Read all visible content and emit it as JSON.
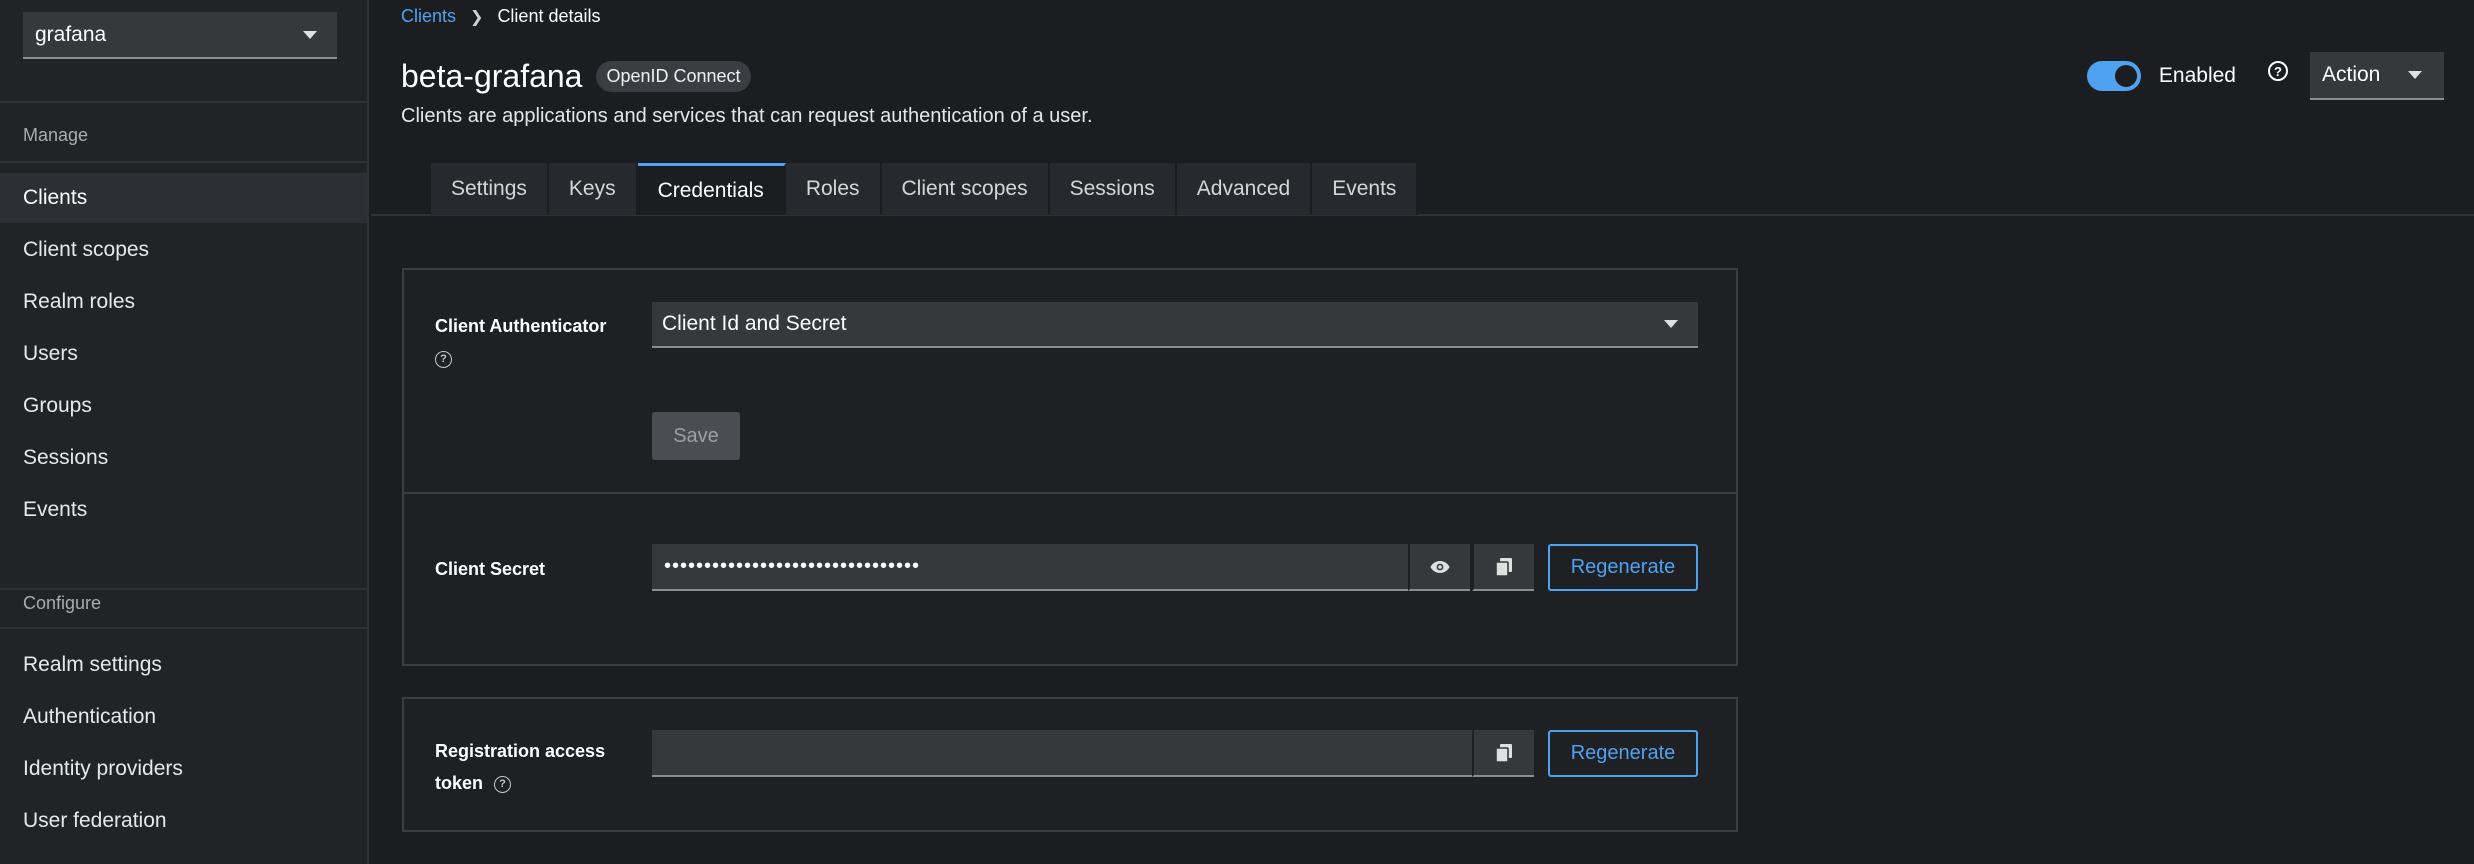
{
  "sidebar": {
    "realm": "grafana",
    "manage_label": "Manage",
    "configure_label": "Configure",
    "manage_items": [
      "Clients",
      "Client scopes",
      "Realm roles",
      "Users",
      "Groups",
      "Sessions",
      "Events"
    ],
    "configure_items": [
      "Realm settings",
      "Authentication",
      "Identity providers",
      "User federation"
    ]
  },
  "breadcrumb": {
    "parent": "Clients",
    "current": "Client details"
  },
  "header": {
    "title": "beta-grafana",
    "badge": "OpenID Connect",
    "subtitle": "Clients are applications and services that can request authentication of a user.",
    "enabled_label": "Enabled",
    "enabled": true,
    "action_label": "Action"
  },
  "tabs": [
    "Settings",
    "Keys",
    "Credentials",
    "Roles",
    "Client scopes",
    "Sessions",
    "Advanced",
    "Events"
  ],
  "active_tab": "Credentials",
  "credentials": {
    "authenticator_label": "Client Authenticator",
    "authenticator_value": "Client Id and Secret",
    "save_label": "Save",
    "secret_label": "Client Secret",
    "secret_value": "••••••••••••••••••••••••••••••••",
    "regenerate_label": "Regenerate",
    "registration_label_line1": "Registration access",
    "registration_label_line2": "token",
    "registration_value": ""
  },
  "colors": {
    "accent": "#4ea2f0",
    "background": "#1b1d21",
    "sidebar": "#212427"
  }
}
